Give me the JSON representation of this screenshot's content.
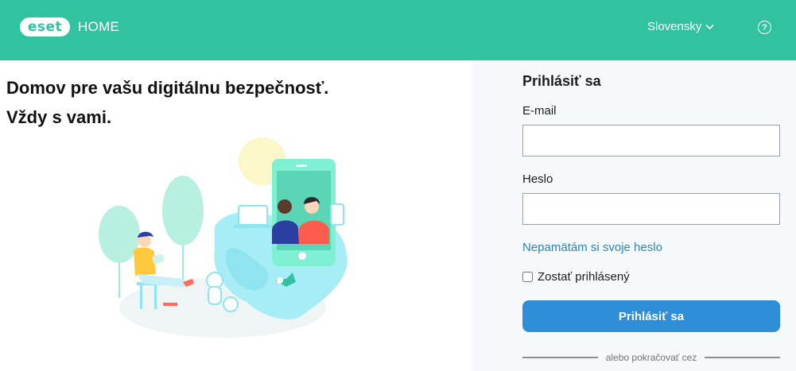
{
  "header": {
    "logo_text": "eset",
    "product": "HOME",
    "language": "Slovensky",
    "help_symbol": "?"
  },
  "hero": {
    "line1": "Domov pre vašu digitálnu bezpečnosť.",
    "line2": "Vždy s vami."
  },
  "login": {
    "title": "Prihlásiť sa",
    "email_label": "E-mail",
    "email_value": "",
    "password_label": "Heslo",
    "password_value": "",
    "forgot_link": "Nepamätám si svoje heslo",
    "remember_label": "Zostať prihlásený",
    "remember_checked": false,
    "submit_label": "Prihlásiť sa",
    "divider_text": "alebo pokračovať cez"
  },
  "colors": {
    "header_bg": "#31c3a0",
    "button_bg": "#2e8fd8",
    "link": "#2a84b8",
    "panel_bg": "#f6f9fa"
  },
  "icons": {
    "language_caret": "chevron-down-icon",
    "help": "help-circle-icon"
  }
}
